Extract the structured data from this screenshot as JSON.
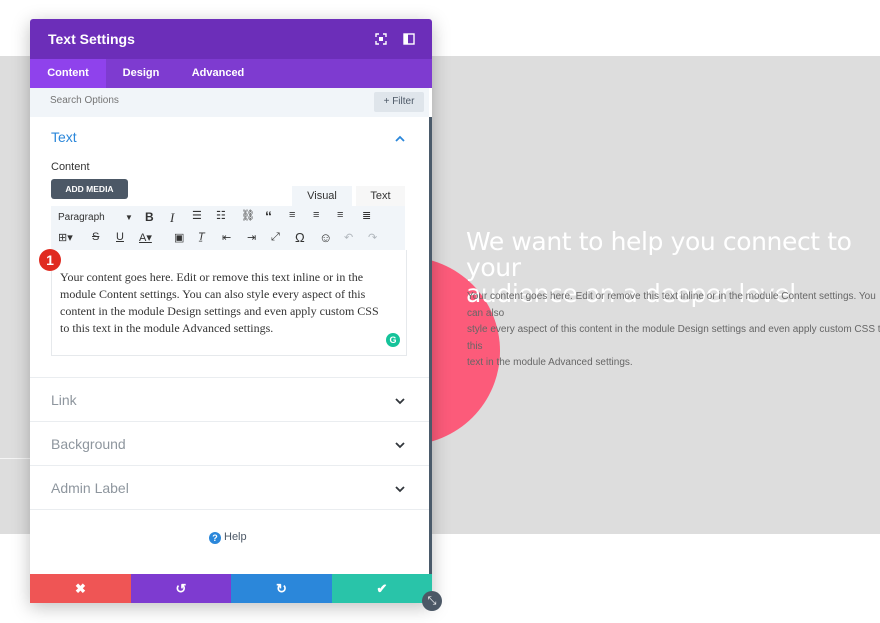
{
  "page": {
    "heading": "We want to help you connect to your\naudience on a deeper level",
    "body": "Your content goes here. Edit or remove this text inline or in the module Content settings. You can also\nstyle every aspect of this content in the module Design settings and even apply custom CSS to this\ntext in the module Advanced settings."
  },
  "modal": {
    "title": "Text Settings",
    "header_icons": [
      "expand-icon",
      "sidebar-toggle-icon"
    ],
    "tabs": [
      {
        "label": "Content",
        "active": true
      },
      {
        "label": "Design",
        "active": false
      },
      {
        "label": "Advanced",
        "active": false
      }
    ],
    "search_placeholder": "Search Options",
    "filter_label": "+ Filter",
    "text_group": {
      "title": "Text",
      "content_label": "Content",
      "add_media": "ADD MEDIA",
      "mode_visual": "Visual",
      "mode_text": "Text",
      "format_select": "Paragraph",
      "editor_text": "Your content goes here. Edit or remove this text inline or in the\nmodule Content settings. You can also style every aspect of this\ncontent in the module Design settings and even apply custom CSS\nto this text in the module Advanced settings.",
      "grammarly": "G",
      "step_badge": "1"
    },
    "groups": [
      {
        "title": "Link"
      },
      {
        "title": "Background"
      },
      {
        "title": "Admin Label"
      }
    ],
    "help_label": "Help",
    "footer": {
      "discard_icon": "✖",
      "undo_icon": "↺",
      "redo_icon": "↻",
      "save_icon": "✔"
    },
    "colors": {
      "header": "#6c2eb9",
      "tab_bar": "#7e3bd0",
      "active_tab": "#8f42ec",
      "discard": "#ef5555",
      "undo": "#7e3bd0",
      "redo": "#2b87da",
      "save": "#29c4a9",
      "accent_circle": "#fc5b7a"
    }
  }
}
